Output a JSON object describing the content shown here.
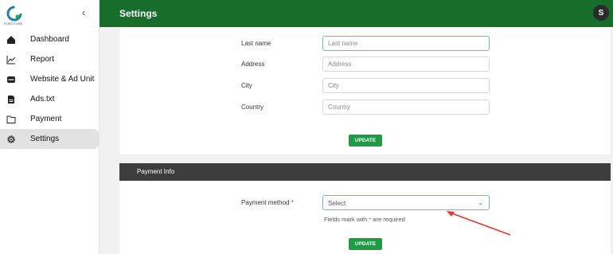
{
  "sidebar": {
    "logo_text": "PUBGTUBE",
    "items": [
      {
        "label": "Dashboard",
        "icon": "home-icon"
      },
      {
        "label": "Report",
        "icon": "line-chart-icon"
      },
      {
        "label": "Website & Ad Unit",
        "icon": "monitor-icon"
      },
      {
        "label": "Ads.txt",
        "icon": "file-icon"
      },
      {
        "label": "Payment",
        "icon": "folder-icon"
      },
      {
        "label": "Settings",
        "icon": "gear-icon",
        "active": true
      }
    ]
  },
  "header": {
    "title": "Settings",
    "avatar_letter": "S",
    "color": "#166e2a"
  },
  "profile_form": {
    "fields": [
      {
        "label": "Last name",
        "placeholder": "Last name"
      },
      {
        "label": "Address",
        "placeholder": "Address"
      },
      {
        "label": "City",
        "placeholder": "City"
      },
      {
        "label": "Country",
        "placeholder": "Country"
      }
    ],
    "update_label": "UPDATE"
  },
  "payment_info": {
    "title": "Payment Info",
    "method_label": "Payment method",
    "required_mark": "*",
    "select_value": "Select",
    "note_prefix": "Fields mark with",
    "note_suffix": "are required",
    "update_label": "UPDATE"
  },
  "colors": {
    "accent_green": "#1f9a45",
    "annotation_red": "#e53935"
  }
}
